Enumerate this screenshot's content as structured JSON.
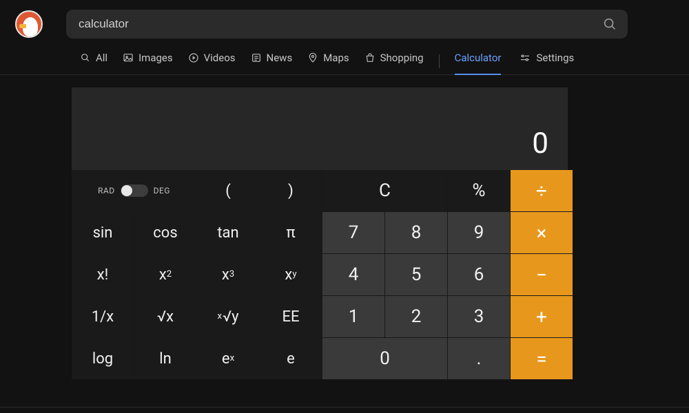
{
  "search": {
    "value": "calculator"
  },
  "tabs": [
    {
      "label": "All"
    },
    {
      "label": "Images"
    },
    {
      "label": "Videos"
    },
    {
      "label": "News"
    },
    {
      "label": "Maps"
    },
    {
      "label": "Shopping"
    },
    {
      "label": "Calculator"
    }
  ],
  "settings_label": "Settings",
  "calc": {
    "display": "0",
    "rad_label": "RAD",
    "deg_label": "DEG",
    "keys": {
      "lparen": "(",
      "rparen": ")",
      "clear": "C",
      "percent": "%",
      "divide": "÷",
      "sin": "sin",
      "cos": "cos",
      "tan": "tan",
      "pi": "π",
      "k7": "7",
      "k8": "8",
      "k9": "9",
      "times": "×",
      "fact_base": "x",
      "fact_suf": "!",
      "x2_base": "x",
      "x2_sup": "2",
      "x3_base": "x",
      "x3_sup": "3",
      "xy_base": "x",
      "xy_sup": "y",
      "k4": "4",
      "k5": "5",
      "k6": "6",
      "minus": "−",
      "inv_pre": "1/",
      "inv_x": "x",
      "sqrt_rad": "√",
      "sqrt_x": "x",
      "root_pre": "x",
      "root_rad": "√",
      "root_y": "y",
      "ee": "EE",
      "k1": "1",
      "k2": "2",
      "k3": "3",
      "plus": "+",
      "log": "log",
      "ln": "ln",
      "ex_base": "e",
      "ex_sup": "x",
      "e": "e",
      "k0": "0",
      "dot": ".",
      "eq": "="
    }
  }
}
